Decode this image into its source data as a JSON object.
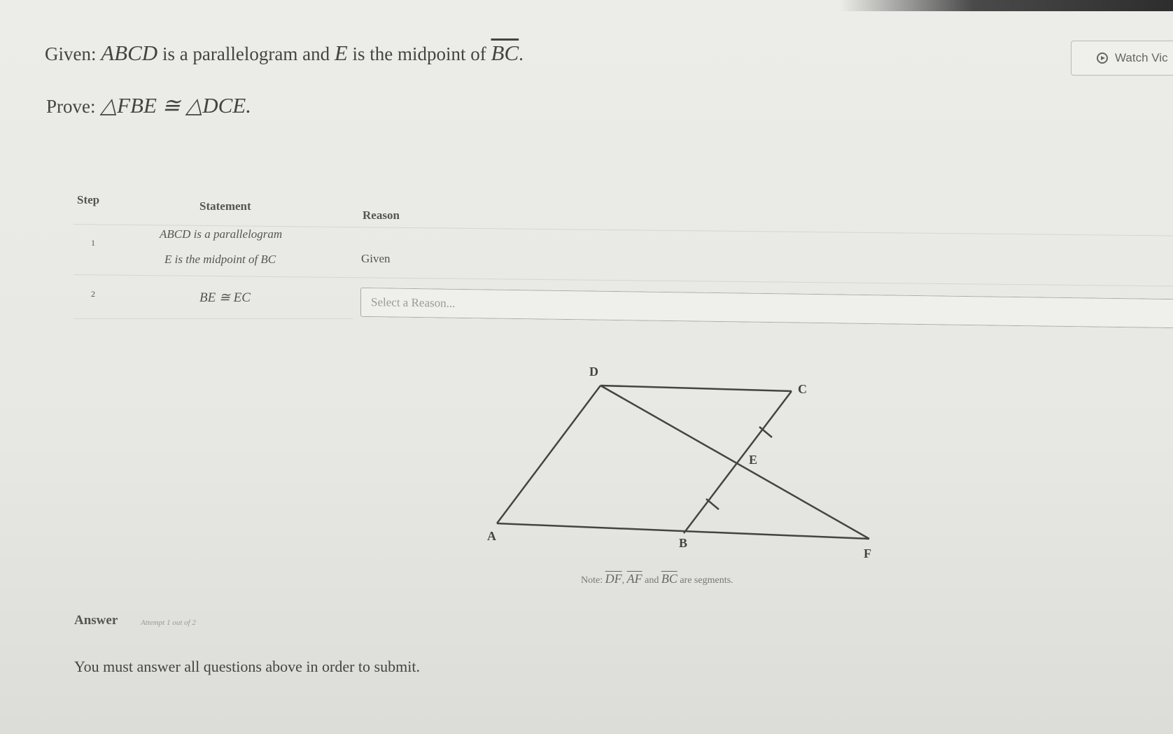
{
  "problem": {
    "given_prefix": "Given:",
    "given_shape": "ABCD",
    "given_mid1": "is a parallelogram and",
    "given_point": "E",
    "given_mid2": "is the midpoint of",
    "given_segment": "BC",
    "given_end": ".",
    "prove_prefix": "Prove:",
    "prove_statement": "△FBE ≅ △DCE."
  },
  "watch_button": {
    "label": "Watch Vic"
  },
  "proof_table": {
    "headers": {
      "step": "Step",
      "statement": "Statement",
      "reason": "Reason"
    },
    "rows": [
      {
        "step": "1",
        "statement_line1": "ABCD is a parallelogram",
        "statement_line2": "E is the midpoint of BC",
        "reason": "Given"
      },
      {
        "step": "2",
        "statement": "BE ≅ EC",
        "reason_placeholder": "Select a Reason..."
      }
    ]
  },
  "diagram": {
    "labels": {
      "A": "A",
      "B": "B",
      "C": "C",
      "D": "D",
      "E": "E",
      "F": "F"
    },
    "note_prefix": "Note:",
    "note_seg1": "DF",
    "note_sep": ",",
    "note_seg2": "AF",
    "note_and": "and",
    "note_seg3": "BC",
    "note_suffix": "are segments."
  },
  "answer": {
    "label": "Answer",
    "attempt": "Attempt 1 out of 2",
    "message": "You must answer all questions above in order to submit."
  }
}
